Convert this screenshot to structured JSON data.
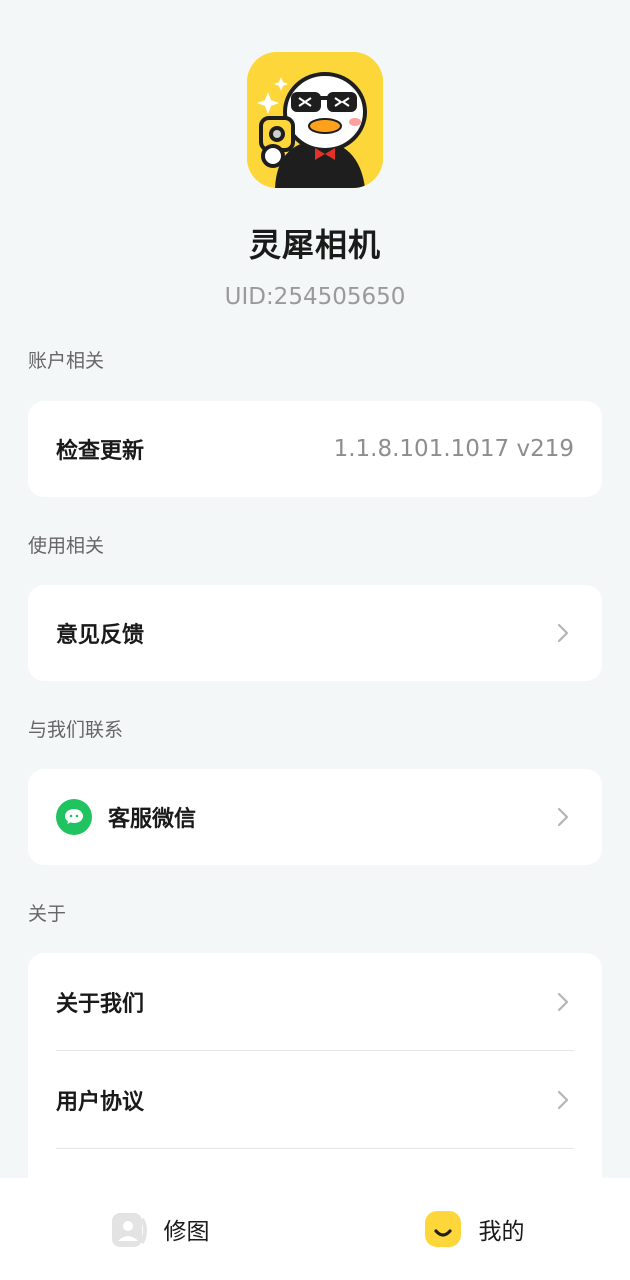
{
  "app": {
    "name": "灵犀相机",
    "uid": "UID:254505650",
    "brand_color": "#fdd63a"
  },
  "sections": [
    {
      "label": "账户相关",
      "items": [
        {
          "label": "检查更新",
          "value": "1.1.8.101.1017 v219"
        }
      ]
    },
    {
      "label": "使用相关",
      "items": [
        {
          "label": "意见反馈",
          "icon": "chevron-right-icon"
        }
      ]
    },
    {
      "label": "与我们联系",
      "items": [
        {
          "label": "客服微信",
          "icon": "wechat-icon",
          "icon_color": "#1fc35f"
        }
      ]
    },
    {
      "label": "关于",
      "items": [
        {
          "label": "关于我们",
          "icon": "chevron-right-icon"
        },
        {
          "label": "用户协议",
          "icon": "chevron-right-icon"
        }
      ]
    }
  ],
  "tabbar": {
    "tabs": [
      {
        "label": "修图",
        "icon": "photo-edit-icon",
        "active": false
      },
      {
        "label": "我的",
        "icon": "smile-face-icon",
        "active": true
      }
    ]
  }
}
